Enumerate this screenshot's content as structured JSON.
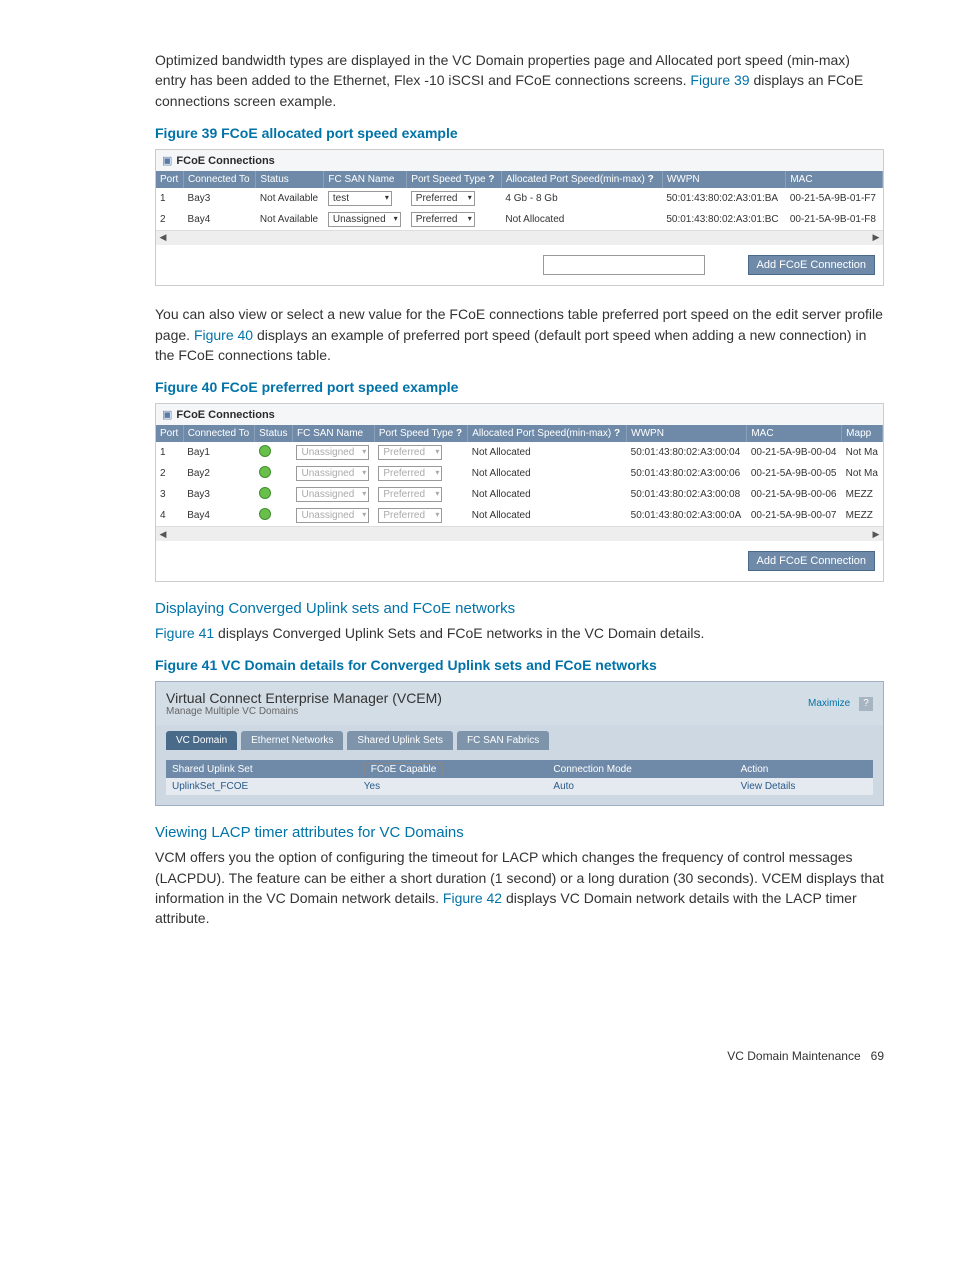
{
  "intro_paragraph": "Optimized bandwidth types are displayed in the VC Domain properties page and Allocated port speed (min-max) entry has been added to the Ethernet, Flex -10 iSCSI and FCoE connections screens. ",
  "intro_link": "Figure 39",
  "intro_after_link": " displays an FCoE connections screen example.",
  "figure39": {
    "title": "Figure 39 FCoE allocated port speed example",
    "panel_title": "FCoE Connections",
    "headers": [
      "Port",
      "Connected To",
      "Status",
      "FC SAN Name",
      "Port Speed Type",
      "?",
      "Allocated Port Speed(min-max)",
      "?",
      "WWPN",
      "MAC"
    ],
    "rows": [
      {
        "port": "1",
        "conn": "Bay3",
        "status": "Not Available",
        "san": "test",
        "speedtype": "Preferred",
        "alloc": "4 Gb - 8 Gb",
        "wwpn": "50:01:43:80:02:A3:01:BA",
        "mac": "00-21-5A-9B-01-F7"
      },
      {
        "port": "2",
        "conn": "Bay4",
        "status": "Not Available",
        "san": "Unassigned",
        "speedtype": "Preferred",
        "alloc": "Not Allocated",
        "wwpn": "50:01:43:80:02:A3:01:BC",
        "mac": "00-21-5A-9B-01-F8"
      }
    ],
    "button": "Add FCoE Connection"
  },
  "para2_before": "You can also view or select a new value for the FCoE connections table preferred port speed on the edit server profile page. ",
  "para2_link": "Figure 40",
  "para2_after": " displays an example of preferred port speed (default port speed when adding a new connection) in the FCoE connections table.",
  "figure40": {
    "title": "Figure 40 FCoE preferred port speed example",
    "panel_title": "FCoE Connections",
    "headers": [
      "Port",
      "Connected To",
      "Status",
      "FC SAN Name",
      "Port Speed Type",
      "?",
      "Allocated Port Speed(min-max)",
      "?",
      "WWPN",
      "MAC",
      "Mapp"
    ],
    "rows": [
      {
        "port": "1",
        "conn": "Bay1",
        "san": "Unassigned",
        "speedtype": "Preferred",
        "alloc": "Not Allocated",
        "wwpn": "50:01:43:80:02:A3:00:04",
        "mac": "00-21-5A-9B-00-04",
        "mapp": "Not Ma"
      },
      {
        "port": "2",
        "conn": "Bay2",
        "san": "Unassigned",
        "speedtype": "Preferred",
        "alloc": "Not Allocated",
        "wwpn": "50:01:43:80:02:A3:00:06",
        "mac": "00-21-5A-9B-00-05",
        "mapp": "Not Ma"
      },
      {
        "port": "3",
        "conn": "Bay3",
        "san": "Unassigned",
        "speedtype": "Preferred",
        "alloc": "Not Allocated",
        "wwpn": "50:01:43:80:02:A3:00:08",
        "mac": "00-21-5A-9B-00-06",
        "mapp": "MEZZ"
      },
      {
        "port": "4",
        "conn": "Bay4",
        "san": "Unassigned",
        "speedtype": "Preferred",
        "alloc": "Not Allocated",
        "wwpn": "50:01:43:80:02:A3:00:0A",
        "mac": "00-21-5A-9B-00-07",
        "mapp": "MEZZ"
      }
    ],
    "button": "Add FCoE Connection"
  },
  "section_converged": {
    "title": "Displaying Converged Uplink sets and FCoE networks",
    "p_before": "",
    "p_link": "Figure 41",
    "p_after": " displays Converged Uplink Sets and FCoE networks in the VC Domain details."
  },
  "figure41": {
    "title": "Figure 41 VC Domain details for Converged Uplink sets and FCoE networks",
    "vcem_title": "Virtual Connect Enterprise Manager (VCEM)",
    "vcem_sub": "Manage Multiple VC Domains",
    "maximize": "Maximize",
    "tabs": [
      "VC Domain",
      "Ethernet Networks",
      "Shared Uplink Sets",
      "FC SAN Fabrics"
    ],
    "thead": [
      "Shared Uplink Set",
      "FCoE Capable",
      "Connection Mode",
      "Action"
    ],
    "trow": {
      "name": "UplinkSet_FCOE",
      "fcoe": "Yes",
      "mode": "Auto",
      "action": "View Details"
    }
  },
  "section_lacp": {
    "title": "Viewing LACP timer attributes for VC Domains",
    "p_before": "VCM offers you the option of configuring the timeout for LACP which changes the frequency of control messages (LACPDU). The feature can be either a short duration (1 second) or a long duration (30 seconds). VCEM displays that information in the VC Domain network details. ",
    "p_link": "Figure 42",
    "p_after": " displays VC Domain network details with the LACP timer attribute."
  },
  "footer": {
    "section": "VC Domain Maintenance",
    "page": "69"
  }
}
